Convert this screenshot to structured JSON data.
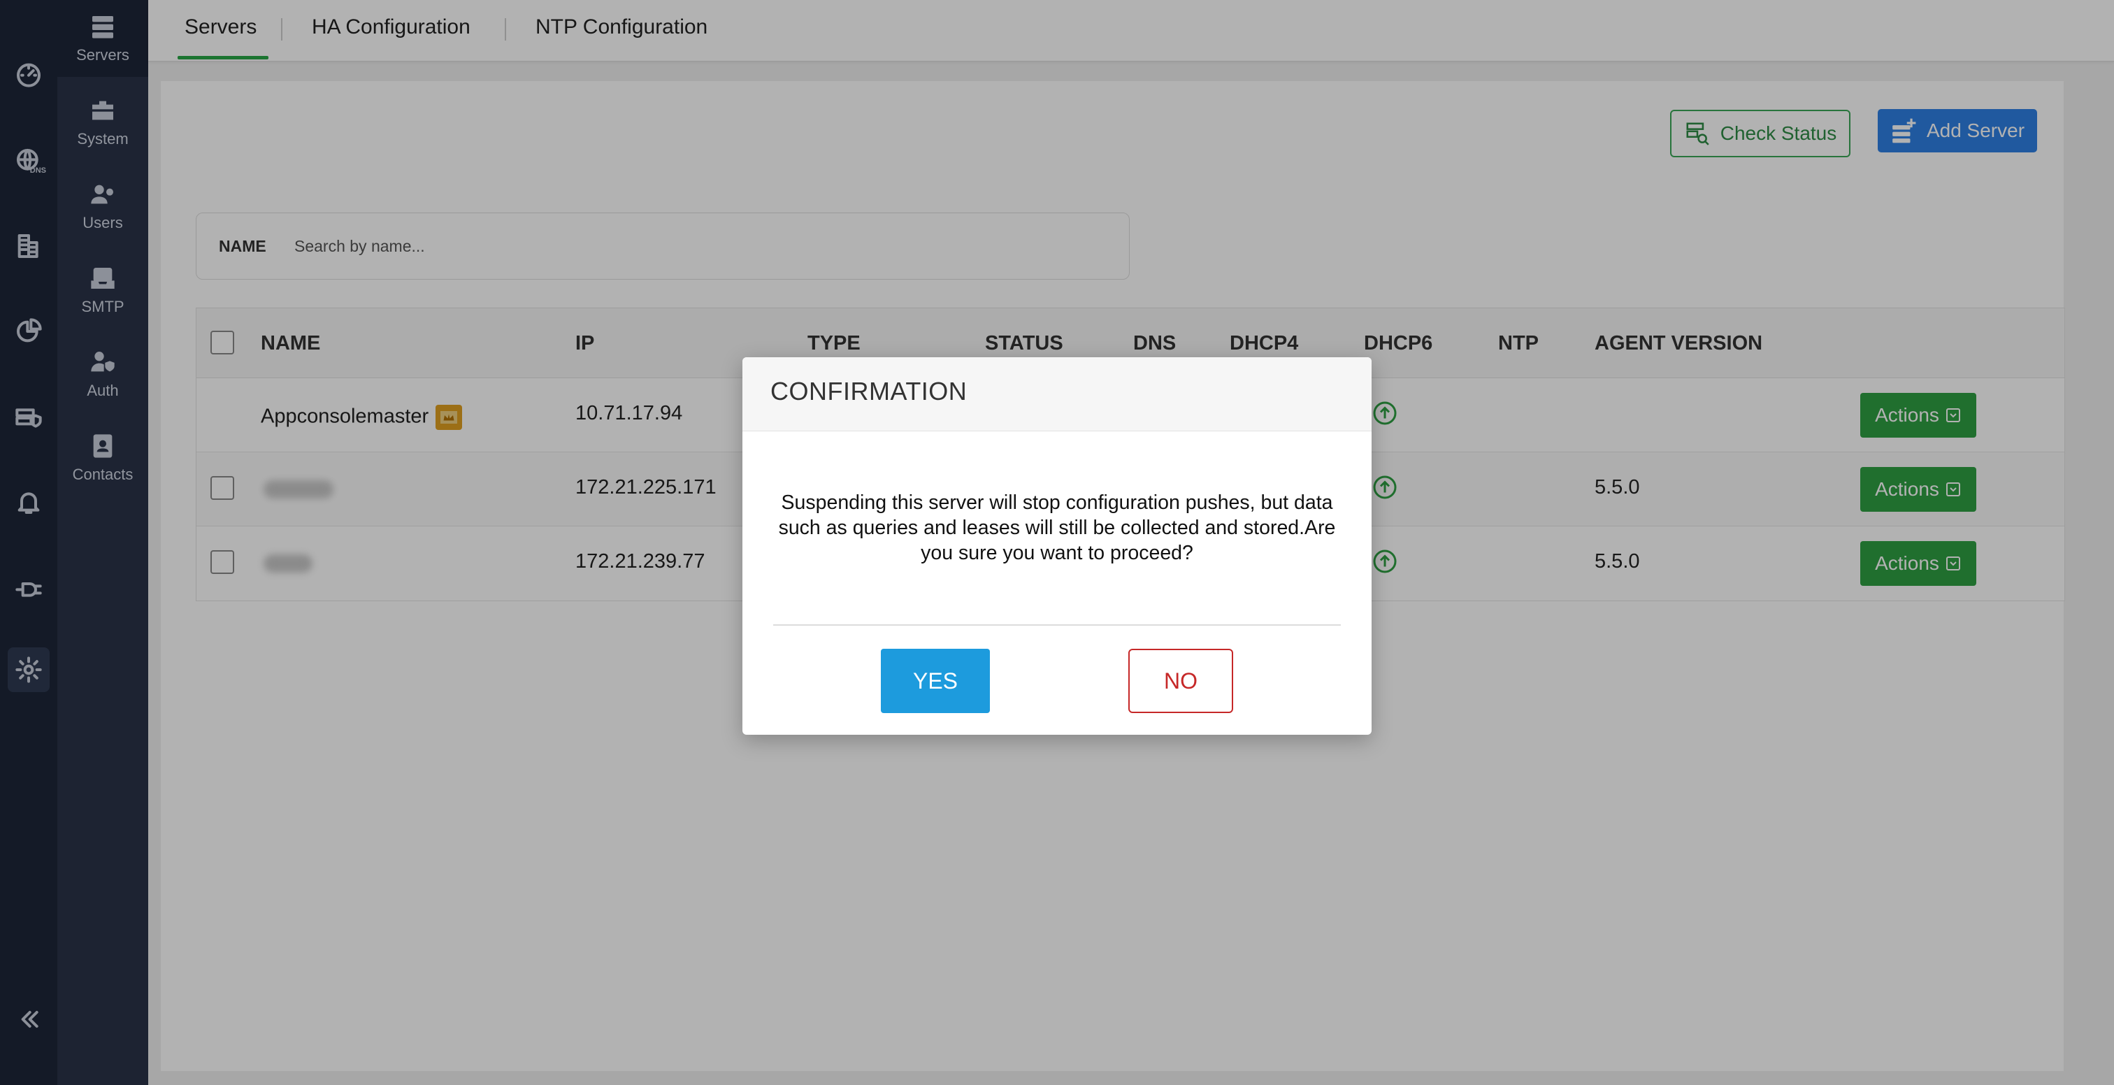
{
  "rail": {
    "icons": [
      "dashboard-icon",
      "dns-globe-icon",
      "building-icon",
      "pie-chart-icon",
      "server-shield-icon",
      "bell-icon",
      "plug-icon",
      "settings-gear-icon",
      "collapse-icon"
    ],
    "dns_tag": "DNS"
  },
  "subnav": {
    "items": [
      {
        "label": "Servers",
        "icon": "servers-icon"
      },
      {
        "label": "System",
        "icon": "toolbox-icon"
      },
      {
        "label": "Users",
        "icon": "users-icon"
      },
      {
        "label": "SMTP",
        "icon": "mail-tray-icon"
      },
      {
        "label": "Auth",
        "icon": "user-shield-icon"
      },
      {
        "label": "Contacts",
        "icon": "contacts-icon"
      }
    ]
  },
  "tabs": [
    {
      "label": "Servers",
      "active": true
    },
    {
      "label": "HA Configuration",
      "active": false
    },
    {
      "label": "NTP Configuration",
      "active": false
    }
  ],
  "toolbar": {
    "check_status": "Check Status",
    "add_server": "Add Server"
  },
  "search": {
    "label": "NAME",
    "placeholder": "Search by name..."
  },
  "table": {
    "columns": [
      "NAME",
      "IP",
      "TYPE",
      "STATUS",
      "DNS",
      "DHCP4",
      "DHCP6",
      "NTP",
      "AGENT VERSION"
    ],
    "rows": [
      {
        "name": "Appconsolemaster",
        "ip": "10.71.17.94",
        "agent_version": "",
        "actions": "Actions"
      },
      {
        "name": "",
        "ip": "172.21.225.171",
        "agent_version": "5.5.0",
        "actions": "Actions"
      },
      {
        "name": "",
        "ip": "172.21.239.77",
        "agent_version": "5.5.0",
        "actions": "Actions"
      }
    ]
  },
  "modal": {
    "title": "CONFIRMATION",
    "message": "Suspending this server will stop configuration pushes, but data such as queries and leases will still be collected and stored.Are you sure you want to proceed?",
    "yes": "YES",
    "no": "NO"
  },
  "colors": {
    "rail_bg": "#1e2638",
    "subnav_bg": "#2a3348",
    "accent_green": "#28a745",
    "add_blue": "#2f80e4",
    "yes_blue": "#1d9bdd",
    "no_red": "#c62828"
  }
}
